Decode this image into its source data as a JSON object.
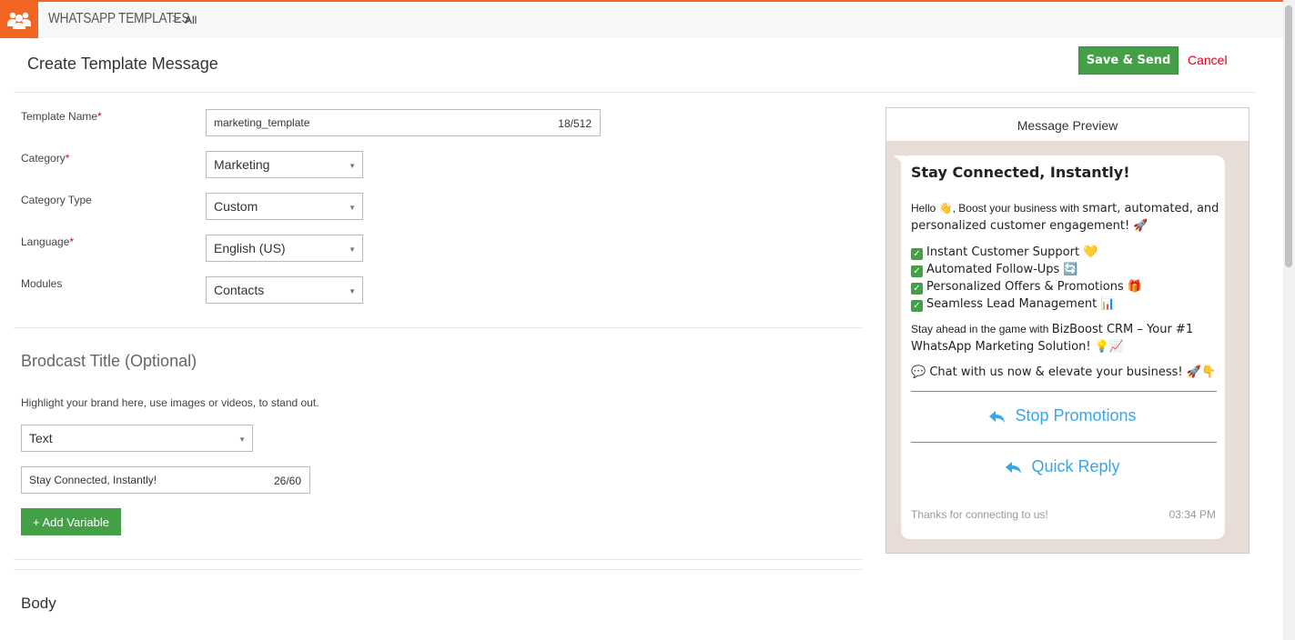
{
  "breadcrumb": {
    "section": "WHATSAPP TEMPLATES",
    "separator": ">",
    "current": "All"
  },
  "page": {
    "title": "Create Template Message"
  },
  "actions": {
    "save_label": "Save & Send",
    "cancel_label": "Cancel"
  },
  "form": {
    "template_name": {
      "label": "Template Name",
      "required": "*",
      "value": "marketing_template",
      "counter": "18/512"
    },
    "category": {
      "label": "Category",
      "required": "*",
      "value": "Marketing"
    },
    "category_type": {
      "label": "Category Type",
      "value": "Custom"
    },
    "language": {
      "label": "Language",
      "required": "*",
      "value": "English (US)"
    },
    "modules": {
      "label": "Modules",
      "value": "Contacts"
    }
  },
  "broadcast": {
    "title": "Brodcast Title (Optional)",
    "helper": "Highlight your brand here, use images or videos, to stand out.",
    "type_value": "Text",
    "title_value": "Stay Connected, Instantly!",
    "title_counter": "26/60",
    "add_variable_label": "+ Add Variable"
  },
  "body_section": {
    "title": "Body"
  },
  "preview": {
    "header": "Message Preview",
    "title": "Stay Connected, Instantly!",
    "intro_a": "Hello 👋, Boost your business with ",
    "intro_b": "smart, automated, and personalized customer engagement! 🚀",
    "features": [
      "Instant Customer Support 💛",
      "Automated Follow-Ups 🔄",
      "Personalized Offers & Promotions 🎁",
      "Seamless Lead Management 📊"
    ],
    "feature_check": "✓",
    "closing_a": "Stay ahead in the game with ",
    "closing_b": "BizBoost CRM – Your #1 WhatsApp Marketing Solution! 💡📈",
    "cta": "💬 Chat with us now & elevate your business! 🚀👇",
    "reply_buttons": [
      "Stop Promotions",
      "Quick Reply"
    ],
    "footer": "Thanks for connecting to us!",
    "time": "03:34 PM"
  },
  "colors": {
    "brand_orange": "#f26522",
    "save_green": "#43a047",
    "cancel_red": "#d9001b",
    "reply_blue": "#35a7e8",
    "preview_bg": "#e8ddd6"
  },
  "icons": {
    "logo": "users-icon",
    "reply": "reply-arrow-icon",
    "check": "check-box-icon",
    "dropdown": "caret-down-icon"
  }
}
